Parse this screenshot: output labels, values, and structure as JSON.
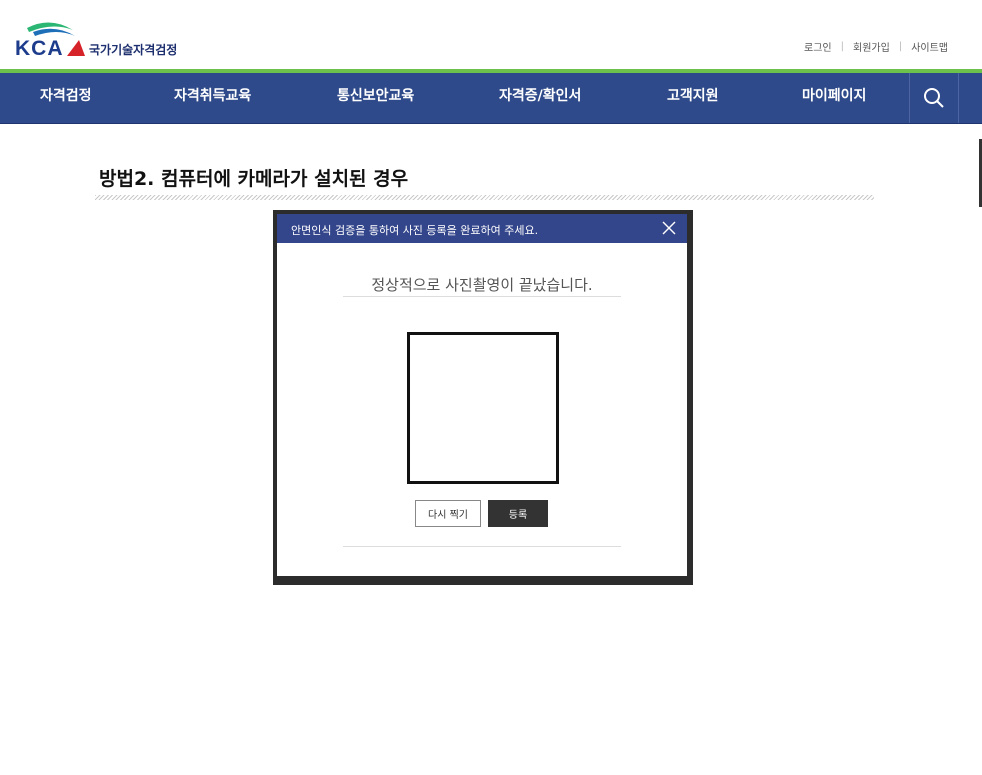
{
  "header": {
    "logo_text": "KCA",
    "logo_sub": "국가기술자격검정",
    "util_links": [
      "로그인",
      "회원가입",
      "사이트맵"
    ]
  },
  "nav": {
    "items": [
      "자격검정",
      "자격취득교육",
      "통신보안교육",
      "자격증/확인서",
      "고객지원",
      "마이페이지"
    ]
  },
  "section": {
    "title": "방법2. 컴퓨터에 카메라가 설치된 경우"
  },
  "modal": {
    "title": "안면인식 검증을 통하여 사진 등록을 완료하여 주세요.",
    "status": "정상적으로 사진촬영이 끝났습니다.",
    "retake_label": "다시 찍기",
    "register_label": "등록"
  },
  "colors": {
    "nav_bg": "#2f4a8a",
    "accent_green": "#6cc24a",
    "modal_header": "#34468b"
  }
}
